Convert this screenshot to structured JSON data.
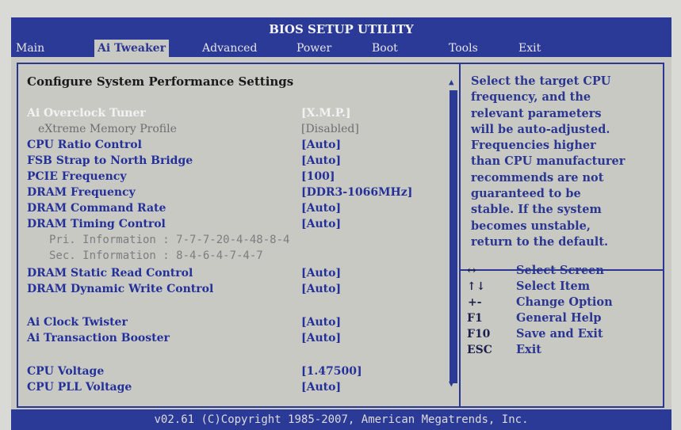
{
  "title": "BIOS SETUP UTILITY",
  "menu": [
    {
      "label": "Main"
    },
    {
      "label": "Ai Tweaker"
    },
    {
      "label": "Advanced"
    },
    {
      "label": "Power"
    },
    {
      "label": "Boot"
    },
    {
      "label": "Tools"
    },
    {
      "label": "Exit"
    }
  ],
  "section_title": "Configure System Performance Settings",
  "settings": [
    {
      "label": "Ai Overclock Tuner",
      "value": "[X.M.P.]"
    },
    {
      "label": "eXtreme Memory Profile",
      "value": "[Disabled]"
    },
    {
      "label": "CPU Ratio Control",
      "value": "[Auto]"
    },
    {
      "label": "FSB Strap to North Bridge",
      "value": "[Auto]"
    },
    {
      "label": "PCIE Frequency",
      "value": "[100]"
    },
    {
      "label": "DRAM Frequency",
      "value": "[DDR3-1066MHz]"
    },
    {
      "label": "DRAM Command Rate",
      "value": "[Auto]"
    },
    {
      "label": "DRAM Timing Control",
      "value": "[Auto]"
    },
    {
      "label": "DRAM Static Read Control",
      "value": "[Auto]"
    },
    {
      "label": "DRAM Dynamic Write Control",
      "value": "[Auto]"
    },
    {
      "label": "Ai Clock Twister",
      "value": "[Auto]"
    },
    {
      "label": "Ai Transaction Booster",
      "value": "[Auto]"
    },
    {
      "label": "CPU Voltage",
      "value": "[1.47500]"
    },
    {
      "label": "CPU PLL Voltage",
      "value": "[Auto]"
    }
  ],
  "info_lines": [
    "Pri. Information : 7-7-7-20-4-48-8-4",
    "Sec. Information : 8-4-6-4-7-4-7"
  ],
  "help_lines": [
    "Select the target CPU",
    "frequency, and the",
    "relevant parameters",
    "will be auto-adjusted.",
    "Frequencies higher",
    "than CPU manufacturer",
    "recommends are not",
    "guaranteed to be",
    "stable. If the system",
    "becomes unstable,",
    "return to the default."
  ],
  "keys": [
    {
      "key": "↔",
      "desc": "Select Screen"
    },
    {
      "key": "↑↓",
      "desc": "Select Item"
    },
    {
      "key": "+-",
      "desc": "Change Option"
    },
    {
      "key": "F1",
      "desc": "General Help"
    },
    {
      "key": "F10",
      "desc": "Save and Exit"
    },
    {
      "key": "ESC",
      "desc": "Exit"
    }
  ],
  "footer": "v02.61 (C)Copyright 1985-2007, American Megatrends, Inc.",
  "colors": {
    "accent": "#2b3a97",
    "background": "#c9c9c4",
    "text_blue": "#24309a"
  }
}
